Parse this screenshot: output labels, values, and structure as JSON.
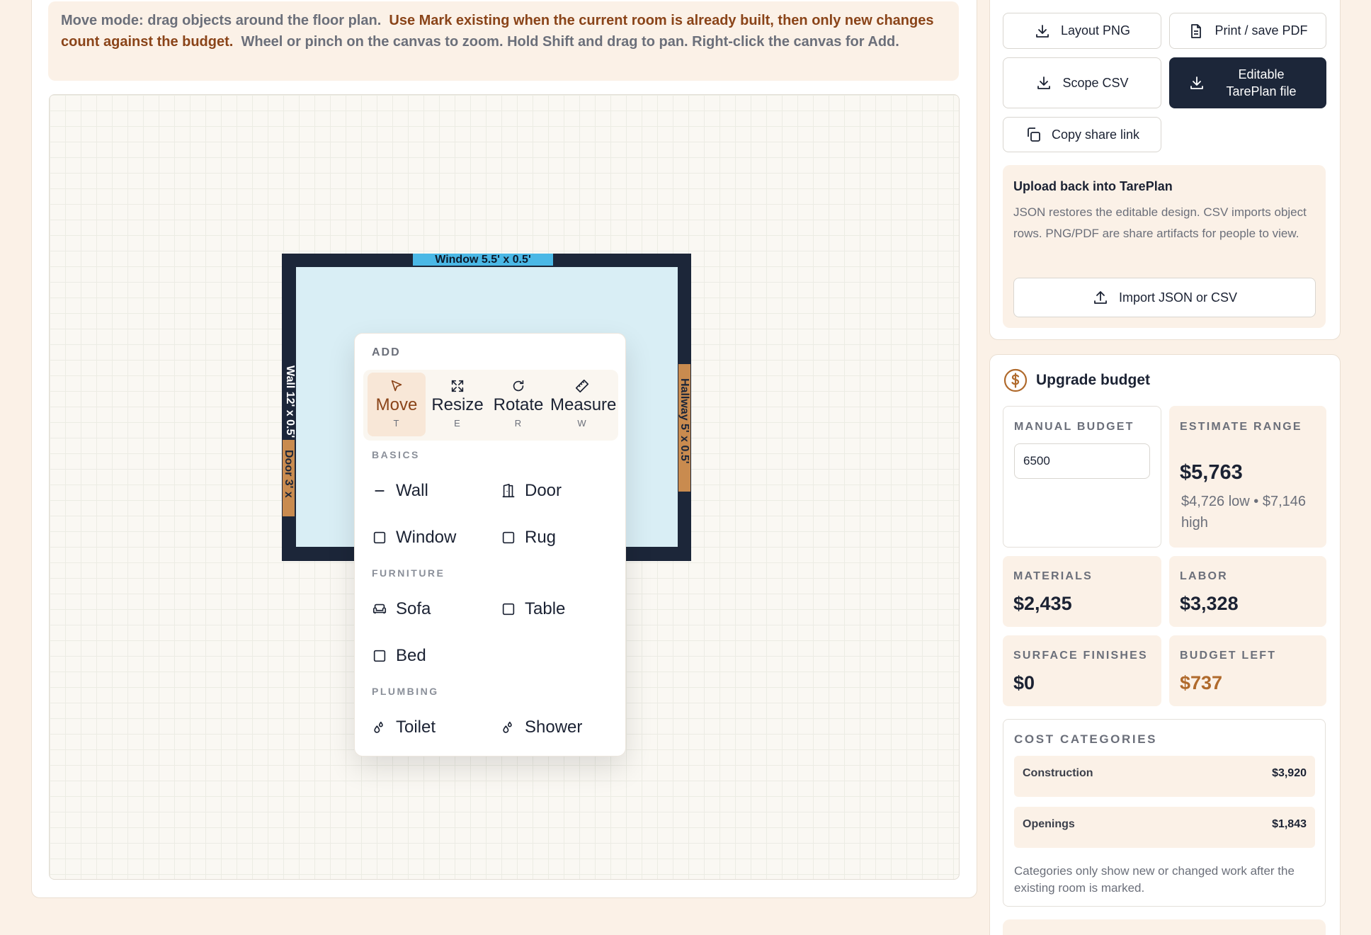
{
  "hint": {
    "part1": "Move mode: drag objects around the floor plan.",
    "part2": "Use Mark existing when the current room is already built, then only new changes count against the budget.",
    "part3": "Wheel or pinch on the canvas to zoom. Hold Shift and drag to pan. Right-click the canvas for Add."
  },
  "room": {
    "window_label": "Window 5.5' x 0.5'",
    "wall_label": "Wall 12' x 0.5'",
    "door_label": "Door 3' x",
    "hallway_label": "Hallway 5' x 0.5'"
  },
  "add_menu": {
    "title": "ADD",
    "tools": [
      {
        "label": "Move",
        "key": "T",
        "icon": "cursor-icon",
        "active": true
      },
      {
        "label": "Resize",
        "key": "E",
        "icon": "resize-icon",
        "active": false
      },
      {
        "label": "Rotate",
        "key": "R",
        "icon": "rotate-icon",
        "active": false
      },
      {
        "label": "Measure",
        "key": "W",
        "icon": "ruler-icon",
        "active": false
      }
    ],
    "sections": {
      "basics": "BASICS",
      "furniture": "FURNITURE",
      "plumbing": "PLUMBING"
    },
    "items": {
      "wall": "Wall",
      "door": "Door",
      "window": "Window",
      "rug": "Rug",
      "sofa": "Sofa",
      "table": "Table",
      "bed": "Bed",
      "toilet": "Toilet",
      "shower": "Shower"
    }
  },
  "export": {
    "layout_png": "Layout PNG",
    "print_pdf": "Print / save PDF",
    "scope_csv": "Scope CSV",
    "editable_file": "Editable TarePlan file",
    "copy_link": "Copy share link"
  },
  "upload": {
    "title": "Upload back into TarePlan",
    "description": "JSON restores the editable design. CSV imports object rows. PNG/PDF are share artifacts for people to view.",
    "import_button": "Import JSON or CSV"
  },
  "budget": {
    "title": "Upgrade budget",
    "manual_label": "MANUAL BUDGET",
    "manual_value": "6500",
    "estimate_label": "ESTIMATE RANGE",
    "estimate_value": "$5,763",
    "estimate_sub": "$4,726 low • $7,146 high",
    "materials_label": "MATERIALS",
    "materials_value": "$2,435",
    "labor_label": "LABOR",
    "labor_value": "$3,328",
    "surface_label": "SURFACE FINISHES",
    "surface_value": "$0",
    "left_label": "BUDGET LEFT",
    "left_value": "$737"
  },
  "cost_categories": {
    "title": "COST CATEGORIES",
    "rows": [
      {
        "name": "Construction",
        "value": "$3,920"
      },
      {
        "name": "Openings",
        "value": "$1,843"
      }
    ],
    "note": "Categories only show new or changed work after the existing room is marked."
  },
  "colors": {
    "accent": "#8a4419",
    "navy": "#1c2639",
    "cream": "#fbf1e7",
    "window_blue": "#4ab8e6",
    "door_orange": "#c98b4f",
    "warn": "#b06a2c"
  }
}
